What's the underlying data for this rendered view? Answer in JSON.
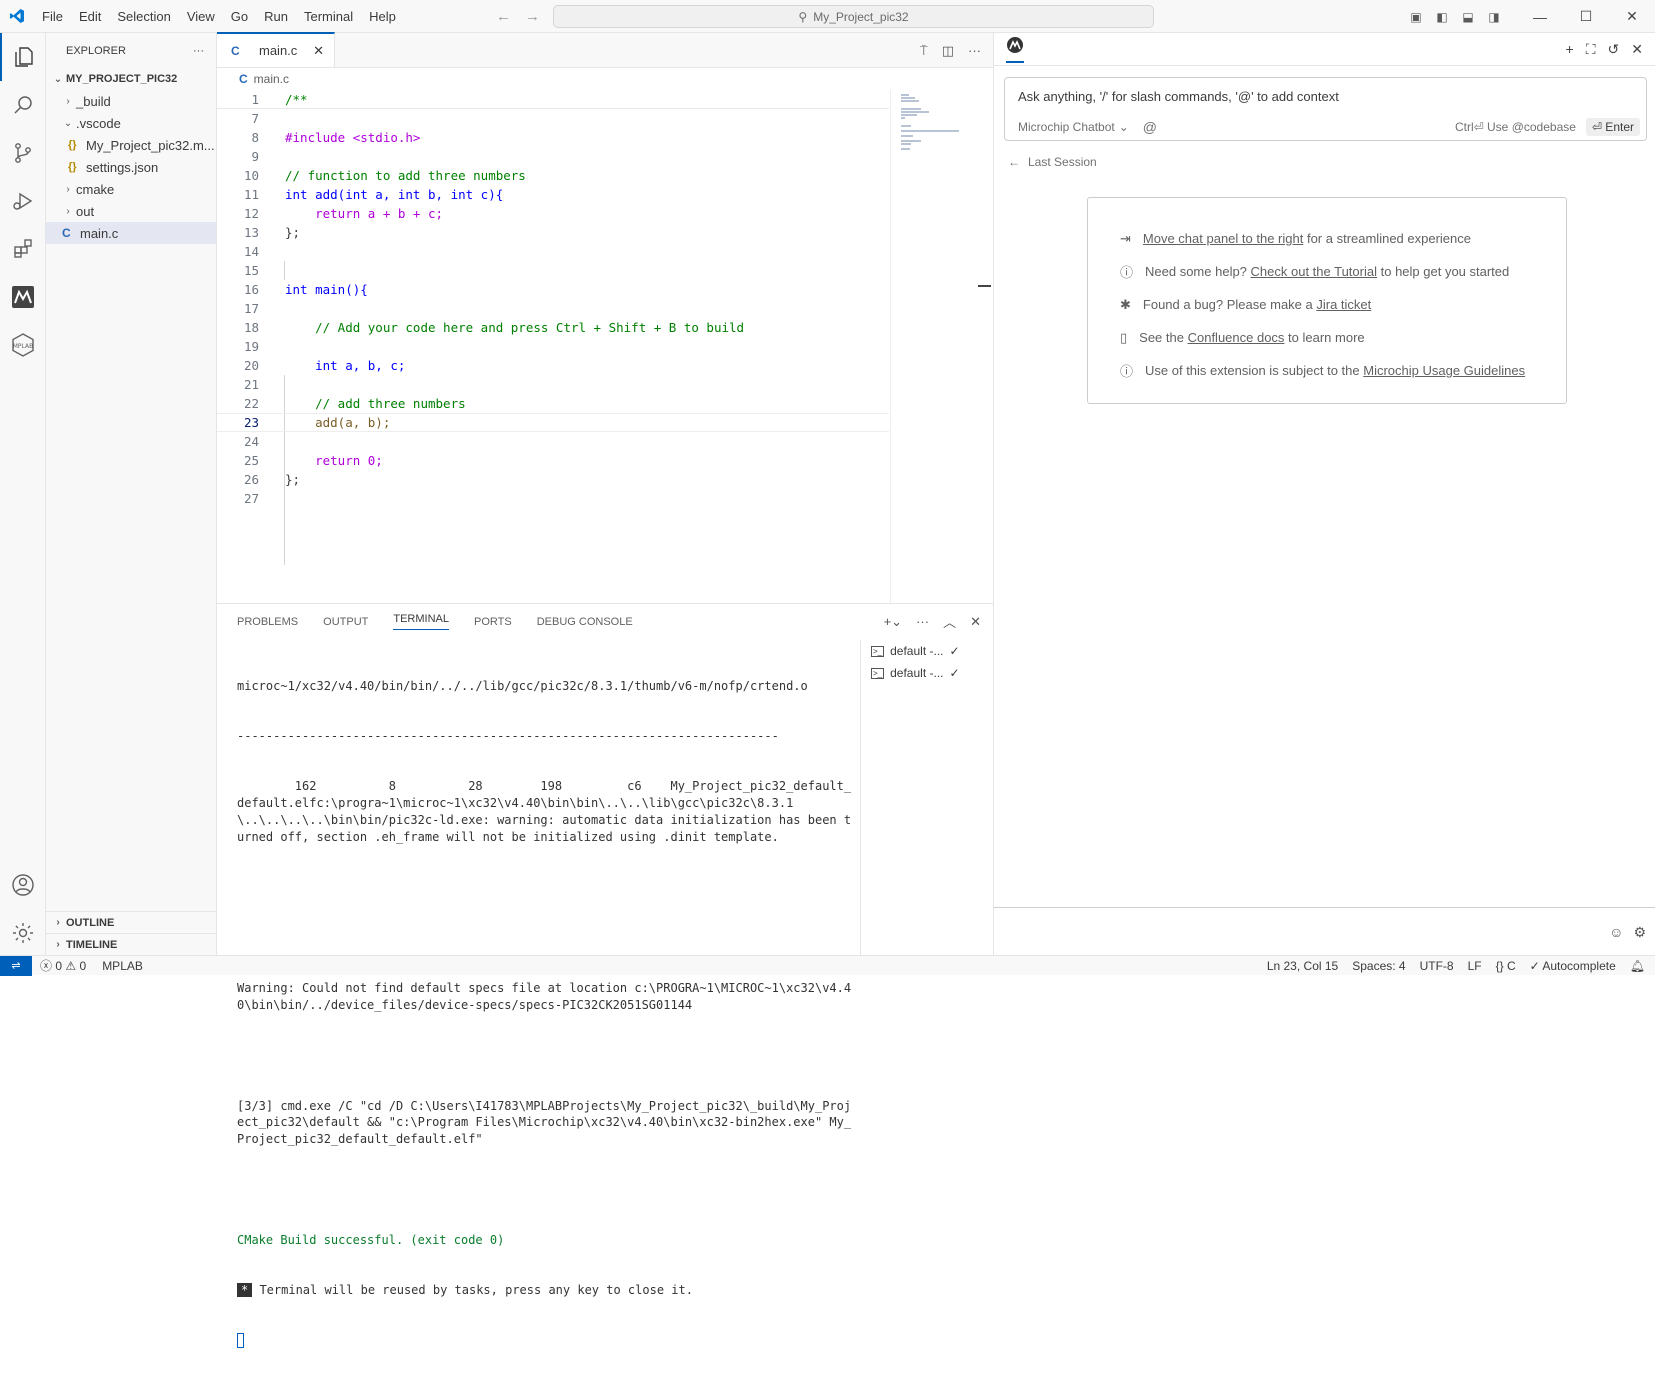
{
  "menu": [
    "File",
    "Edit",
    "Selection",
    "View",
    "Go",
    "Run",
    "Terminal",
    "Help"
  ],
  "search": {
    "text": "My_Project_pic32"
  },
  "explorer": {
    "title": "EXPLORER",
    "project": "MY_PROJECT_PIC32",
    "items": [
      {
        "label": "_build"
      },
      {
        "label": ".vscode"
      },
      {
        "label": "My_Project_pic32.m..."
      },
      {
        "label": "settings.json"
      },
      {
        "label": "cmake"
      },
      {
        "label": "out"
      },
      {
        "label": "main.c"
      }
    ],
    "outline": "OUTLINE",
    "timeline": "TIMELINE"
  },
  "editor": {
    "tab_label": "main.c",
    "breadcrumb": "main.c",
    "lines": [
      {
        "n": "1",
        "t": "/**"
      },
      {
        "n": "7",
        "t": ""
      },
      {
        "n": "8",
        "t": "#include <stdio.h>"
      },
      {
        "n": "9",
        "t": ""
      },
      {
        "n": "10",
        "t": "// function to add three numbers"
      },
      {
        "n": "11",
        "t": "int add(int a, int b, int c){"
      },
      {
        "n": "12",
        "t": "    return a + b + c;"
      },
      {
        "n": "13",
        "t": "};"
      },
      {
        "n": "14",
        "t": ""
      },
      {
        "n": "15",
        "t": ""
      },
      {
        "n": "16",
        "t": "int main(){"
      },
      {
        "n": "17",
        "t": ""
      },
      {
        "n": "18",
        "t": "    // Add your code here and press Ctrl + Shift + B to build"
      },
      {
        "n": "19",
        "t": ""
      },
      {
        "n": "20",
        "t": "    int a, b, c;"
      },
      {
        "n": "21",
        "t": ""
      },
      {
        "n": "22",
        "t": "    // add three numbers"
      },
      {
        "n": "23",
        "t": "    add(a, b);"
      },
      {
        "n": "24",
        "t": ""
      },
      {
        "n": "25",
        "t": "    return 0;"
      },
      {
        "n": "26",
        "t": "};"
      },
      {
        "n": "27",
        "t": ""
      }
    ]
  },
  "panel": {
    "tabs": [
      "PROBLEMS",
      "OUTPUT",
      "TERMINAL",
      "PORTS",
      "DEBUG CONSOLE"
    ],
    "terminal_lines": [
      "microc~1/xc32/v4.40/bin/bin/../../lib/gcc/pic32c/8.3.1/thumb/v6-m/nofp/crtend.o",
      "---------------------------------------------------------------------------",
      "        162          8          28        198         c6    My_Project_pic32_default_default.elfc:\\progra~1\\microc~1\\xc32\\v4.40\\bin\\bin\\..\\..\\lib\\gcc\\pic32c\\8.3.1\\..\\..\\..\\..\\bin\\bin/pic32c-ld.exe: warning: automatic data initialization has been turned off, section .eh_frame will not be initialized using .dinit template.",
      "",
      "",
      "Warning: Could not find default specs file at location c:\\PROGRA~1\\MICROC~1\\xc32\\v4.40\\bin\\bin/../device_files/device-specs/specs-PIC32CK2051SG01144",
      "",
      "[3/3] cmd.exe /C \"cd /D C:\\Users\\I41783\\MPLABProjects\\My_Project_pic32\\_build\\My_Project_pic32\\default && \"c:\\Program Files\\Microchip\\xc32\\v4.40\\bin\\xc32-bin2hex.exe\" My_Project_pic32_default_default.elf\"",
      ""
    ],
    "build_ok": "CMake Build successful. (exit code 0)",
    "reuse_marker": "*",
    "reuse_msg": " Terminal will be reused by tasks, press any key to close it.",
    "terminal_instances": [
      "default -...",
      "default -..."
    ]
  },
  "chat": {
    "input_placeholder": "Ask anything, '/' for slash commands, '@' to add context",
    "model": "Microchip Chatbot",
    "at": "@",
    "shortcut": "Ctrl⏎ Use @codebase",
    "enter": "⏎ Enter",
    "last_session": "Last Session",
    "info": [
      {
        "link": "Move chat panel to the right",
        "after": " for a streamlined experience",
        "before": ""
      },
      {
        "before": "Need some help? ",
        "link": "Check out the Tutorial",
        "after": " to help get you started"
      },
      {
        "before": "Found a bug? Please make a ",
        "link": "Jira ticket",
        "after": ""
      },
      {
        "before": "See the ",
        "link": "Confluence docs",
        "after": " to learn more"
      },
      {
        "before": "Use of this extension is subject to the ",
        "link": "Microchip Usage Guidelines",
        "after": ""
      }
    ]
  },
  "status": {
    "errors": "0",
    "warnings": "0",
    "mplab": "MPLAB",
    "position": "Ln 23, Col 15",
    "spaces": "Spaces: 4",
    "encoding": "UTF-8",
    "eol": "LF",
    "language": "C",
    "autocomplete": "Autocomplete"
  },
  "colors": {
    "accent": "#005fb8",
    "success": "#0a7d2c"
  }
}
